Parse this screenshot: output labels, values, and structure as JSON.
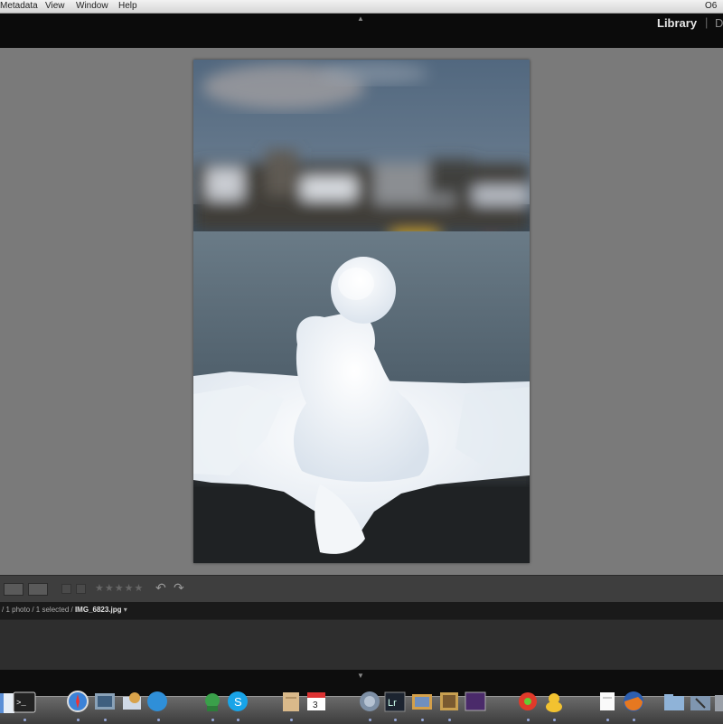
{
  "menubar": {
    "items": [
      "Metadata",
      "View",
      "Window",
      "Help"
    ],
    "right_text": "O6"
  },
  "header": {
    "active_module": "Library",
    "separator": "|",
    "next_module_partial": "D"
  },
  "toolbar": {
    "stars": "★★★★★",
    "rotate_left": "↶",
    "rotate_right": "↷"
  },
  "pathbar": {
    "prefix": "/ 1 photo / 1 selected /",
    "filename": "IMG_6823.jpg",
    "dropdown": "▾"
  },
  "dock": {
    "apps": [
      "Finder",
      "Terminal",
      "Safari",
      "Preview",
      "Mail",
      "Finder",
      "Adium",
      "Skype",
      "Script Editor",
      "iCal",
      "Network Utility",
      "Lightroom",
      "iPhoto",
      "Photo Booth",
      "Alfred",
      "Growl",
      "Cyberduck",
      "TextEdit",
      "Firefox",
      "Downloads",
      "Utilities",
      "Trash"
    ]
  }
}
